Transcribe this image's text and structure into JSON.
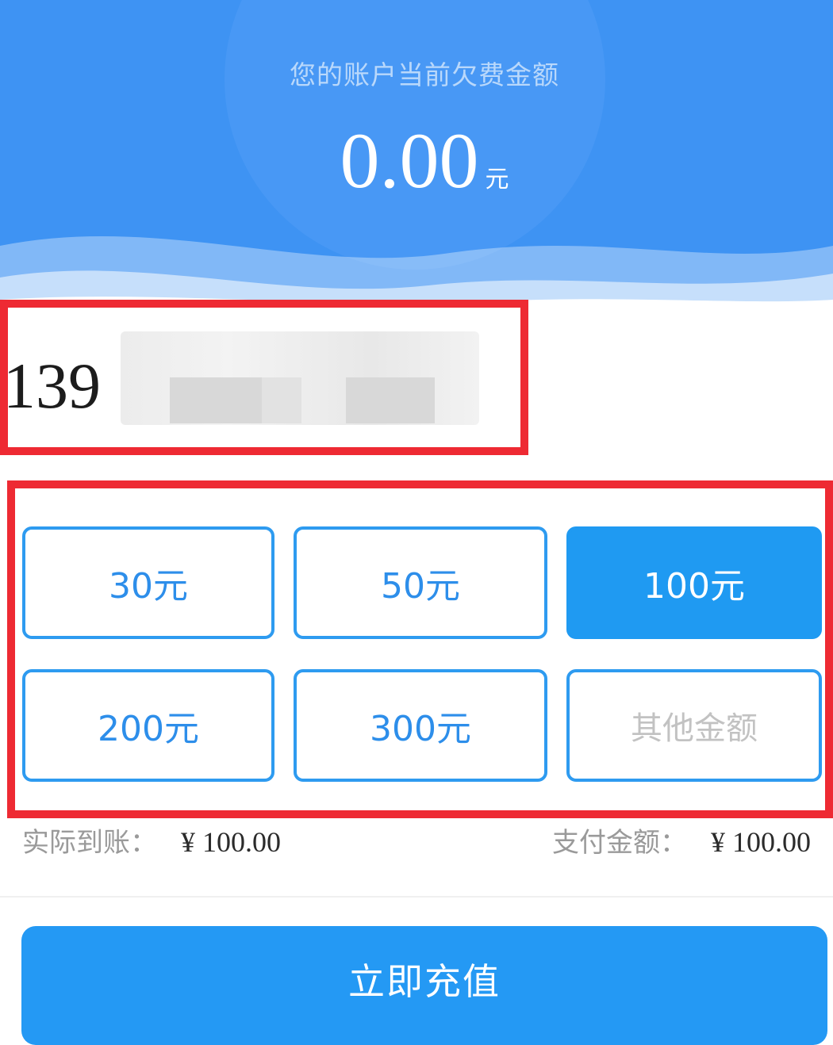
{
  "header": {
    "label": "您的账户当前欠费金额",
    "amount": "0.00",
    "unit": "元"
  },
  "phone": {
    "prefix": "139"
  },
  "options": [
    {
      "label": "30元",
      "selected": false
    },
    {
      "label": "50元",
      "selected": false
    },
    {
      "label": "100元",
      "selected": true
    },
    {
      "label": "200元",
      "selected": false
    },
    {
      "label": "300元",
      "selected": false
    },
    {
      "label": "其他金额",
      "selected": false
    }
  ],
  "summary": {
    "received_label": "实际到账：",
    "received_value": "¥ 100.00",
    "pay_label": "支付金额：",
    "pay_value": "¥ 100.00"
  },
  "submit": {
    "label": "立即充值"
  },
  "colors": {
    "header_blue": "#3e93f3",
    "accent_blue": "#2e9bf0",
    "highlight_red": "#ee2a33"
  }
}
